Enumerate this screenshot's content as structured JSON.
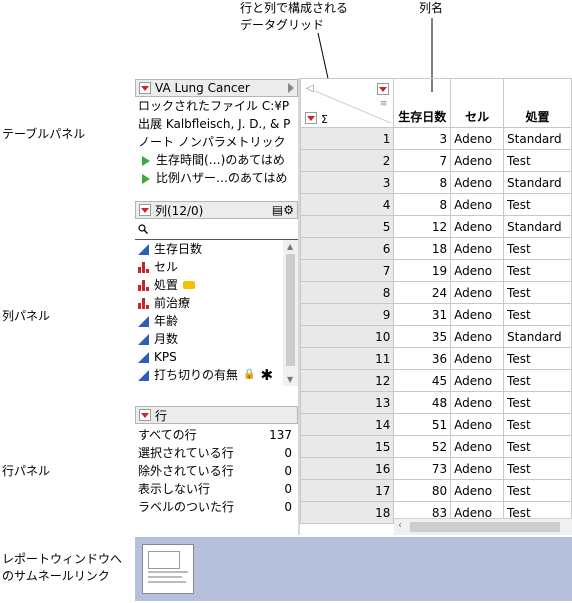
{
  "callouts": {
    "grid_label_line1": "行と列で構成される",
    "grid_label_line2": "データグリッド",
    "column_name": "列名",
    "table_panel": "テーブルパネル",
    "column_panel": "列パネル",
    "row_panel": "行パネル",
    "report_link_line1": "レポートウィンドウへ",
    "report_link_line2": "のサムネールリンク"
  },
  "table_panel": {
    "title": "VA Lung Cancer",
    "lines": [
      "ロックされたファイル  C:¥P",
      "出展  Kalbfleisch, J. D., & P",
      "ノート  ノンパラメトリック"
    ],
    "scripts": [
      "生存時間(…)のあてはめ",
      "比例ハザー…のあてはめ"
    ]
  },
  "columns_panel": {
    "title": "列(12/0)",
    "search_icon": "search-icon",
    "items": [
      {
        "label": "生存日数",
        "type": "continuous"
      },
      {
        "label": "セル",
        "type": "nominal"
      },
      {
        "label": "処置",
        "type": "nominal",
        "extra": "tag-icon"
      },
      {
        "label": "前治療",
        "type": "nominal"
      },
      {
        "label": "年齢",
        "type": "continuous"
      },
      {
        "label": "月数",
        "type": "continuous"
      },
      {
        "label": "KPS",
        "type": "continuous"
      },
      {
        "label": "打ち切りの有無",
        "type": "continuous",
        "extra": "lock-icon"
      }
    ]
  },
  "rows_panel": {
    "title": "行",
    "items": [
      {
        "label": "すべての行",
        "value": "137"
      },
      {
        "label": "選択されている行",
        "value": "0"
      },
      {
        "label": "除外されている行",
        "value": "0"
      },
      {
        "label": "表示しない行",
        "value": "0"
      },
      {
        "label": "ラベルのついた行",
        "value": "0"
      }
    ]
  },
  "grid": {
    "headers": [
      "生存日数",
      "セル",
      "処置"
    ],
    "rows": [
      [
        "1",
        "3",
        "Adeno",
        "Standard"
      ],
      [
        "2",
        "7",
        "Adeno",
        "Test"
      ],
      [
        "3",
        "8",
        "Adeno",
        "Standard"
      ],
      [
        "4",
        "8",
        "Adeno",
        "Test"
      ],
      [
        "5",
        "12",
        "Adeno",
        "Standard"
      ],
      [
        "6",
        "18",
        "Adeno",
        "Test"
      ],
      [
        "7",
        "19",
        "Adeno",
        "Test"
      ],
      [
        "8",
        "24",
        "Adeno",
        "Test"
      ],
      [
        "9",
        "31",
        "Adeno",
        "Test"
      ],
      [
        "10",
        "35",
        "Adeno",
        "Standard"
      ],
      [
        "11",
        "36",
        "Adeno",
        "Test"
      ],
      [
        "12",
        "45",
        "Adeno",
        "Test"
      ],
      [
        "13",
        "48",
        "Adeno",
        "Test"
      ],
      [
        "14",
        "51",
        "Adeno",
        "Test"
      ],
      [
        "15",
        "52",
        "Adeno",
        "Test"
      ],
      [
        "16",
        "73",
        "Adeno",
        "Test"
      ],
      [
        "17",
        "80",
        "Adeno",
        "Test"
      ],
      [
        "18",
        "83",
        "Adeno",
        "Test"
      ]
    ]
  },
  "colors": {
    "accent_red": "#d2232a",
    "thumbnail_bar": "#b6bfdc",
    "row_number_bg": "#e9e9e9"
  }
}
